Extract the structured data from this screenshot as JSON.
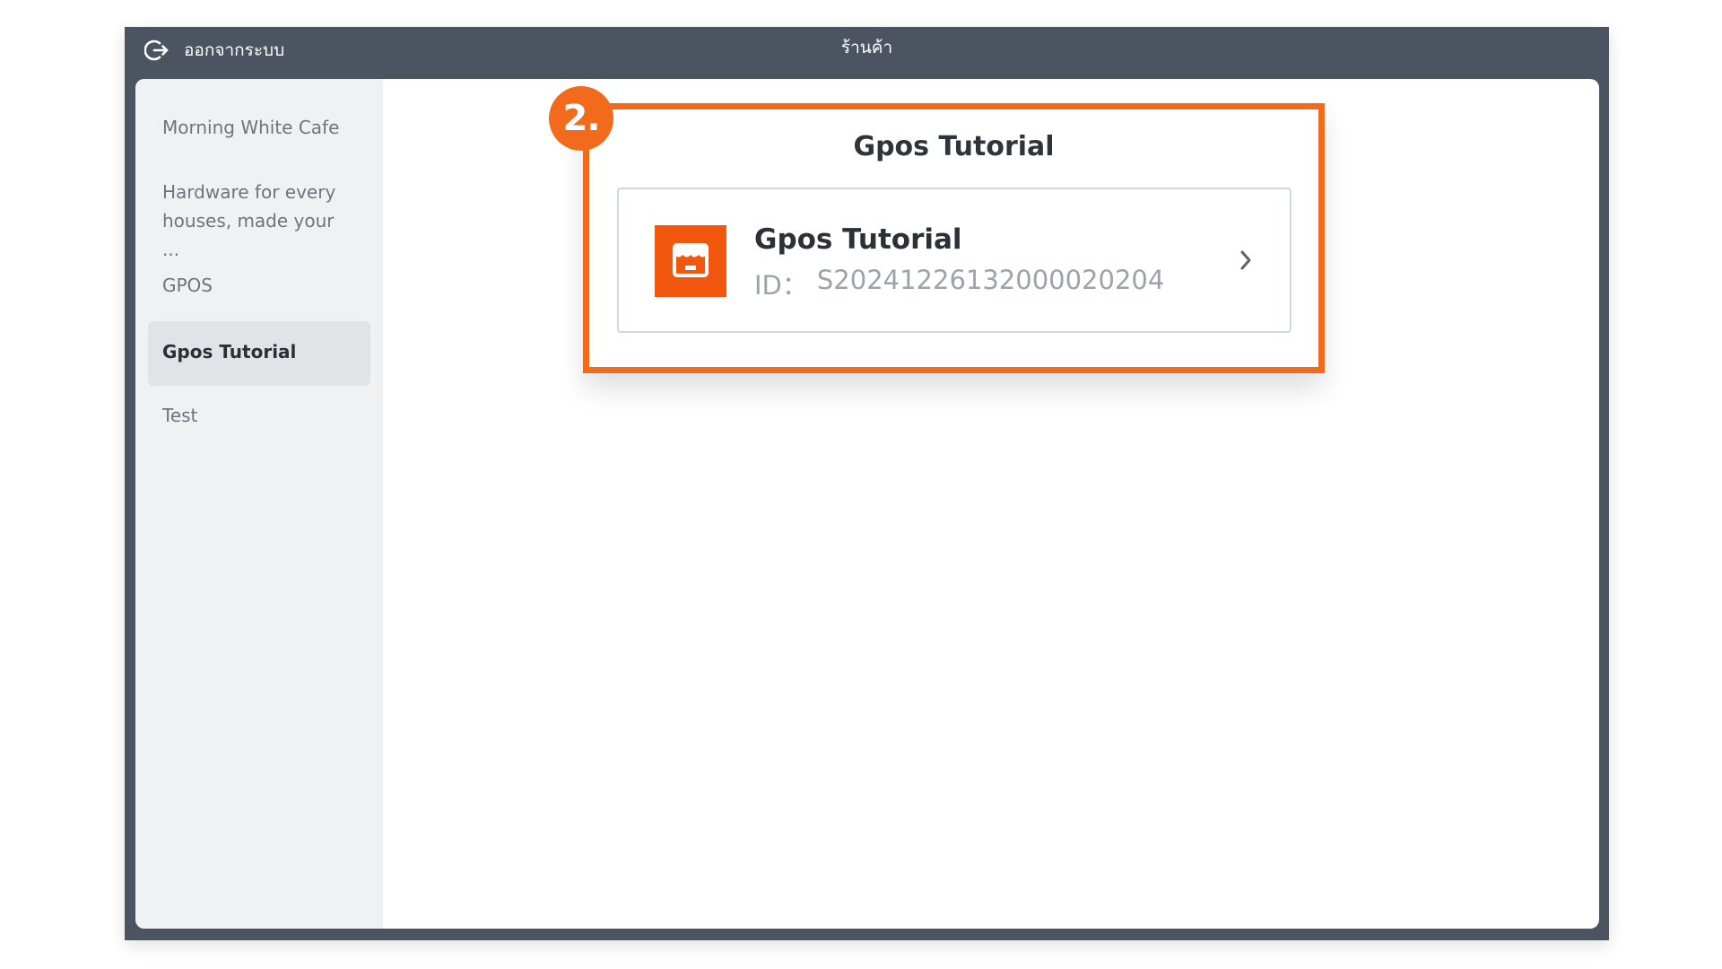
{
  "topbar": {
    "logout_label": "ออกจากระบบ",
    "title": "ร้านค้า"
  },
  "sidebar": {
    "items": [
      {
        "label": "Morning White Cafe",
        "active": false
      },
      {
        "label_line1": "Hardware for every",
        "label_line2": "houses, made your ...",
        "active": false
      },
      {
        "label": "GPOS",
        "active": false
      },
      {
        "label": "Gpos Tutorial",
        "active": true
      },
      {
        "label": "Test",
        "active": false
      }
    ]
  },
  "store_panel": {
    "title": "Gpos Tutorial",
    "card": {
      "name": "Gpos Tutorial",
      "id_label": "ID：",
      "id_value": "S20241226132000020204"
    }
  },
  "annotation": {
    "step_label": "2."
  },
  "colors": {
    "accent": "#f26a1b",
    "topbar": "#4d5461",
    "sidebar": "#f0f1f3",
    "store_logo": "#f2570f"
  },
  "icons": {
    "logout": "logout-icon",
    "store": "store-icon",
    "chevron": "chevron-right-icon"
  }
}
